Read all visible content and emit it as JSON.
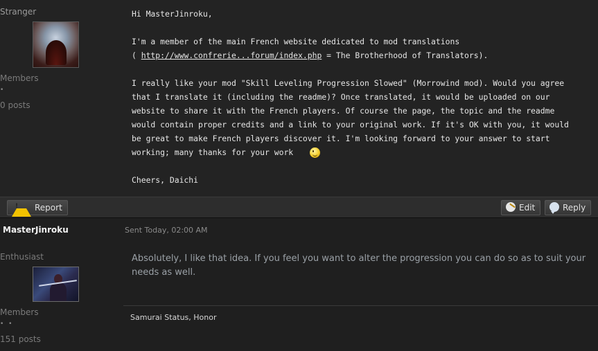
{
  "post1": {
    "author": "Stranger",
    "rank": "Members",
    "pip": "•",
    "posts": "0 posts",
    "greeting": "Hi MasterJinroku,",
    "para1_line1": "I'm a member of the main French website dedicated to mod translations",
    "para1_line2_pre": "( ",
    "para1_link": "http://www.confrerie...forum/index.php",
    "para1_line2_post": " = The Brotherhood of Translators).",
    "para2": "I really like your mod \"Skill Leveling Progression Slowed\" (Morrowind mod). Would you agree\nthat I translate it (including the readme)? Once translated, it would be uploaded on our\nwebsite to share it with the French players. Of course the page, the topic and the readme\nwould contain proper credits and a link to your original work. If it's OK with you, it would\nbe great to make French players discover it. I'm looking forward to your answer to start\nworking; many thanks for your work",
    "closing": "Cheers, Daichi"
  },
  "actions": {
    "report": "Report",
    "edit": "Edit",
    "reply": "Reply"
  },
  "post2": {
    "author": "MasterJinroku",
    "sent": "Sent Today, 02:00 AM",
    "rank": "Enthusiast",
    "group": "Members",
    "pips": "• •",
    "posts": "151 posts",
    "message": "Absolutely, I like that idea. If you feel you want to alter the progression you can do so as to suit your needs as well.",
    "signature": "Samurai Status, Honor"
  },
  "icons": {
    "report": "warning-icon",
    "edit": "edit-icon",
    "reply": "speech-bubble-icon",
    "smiley": "wink-smiley-icon"
  }
}
